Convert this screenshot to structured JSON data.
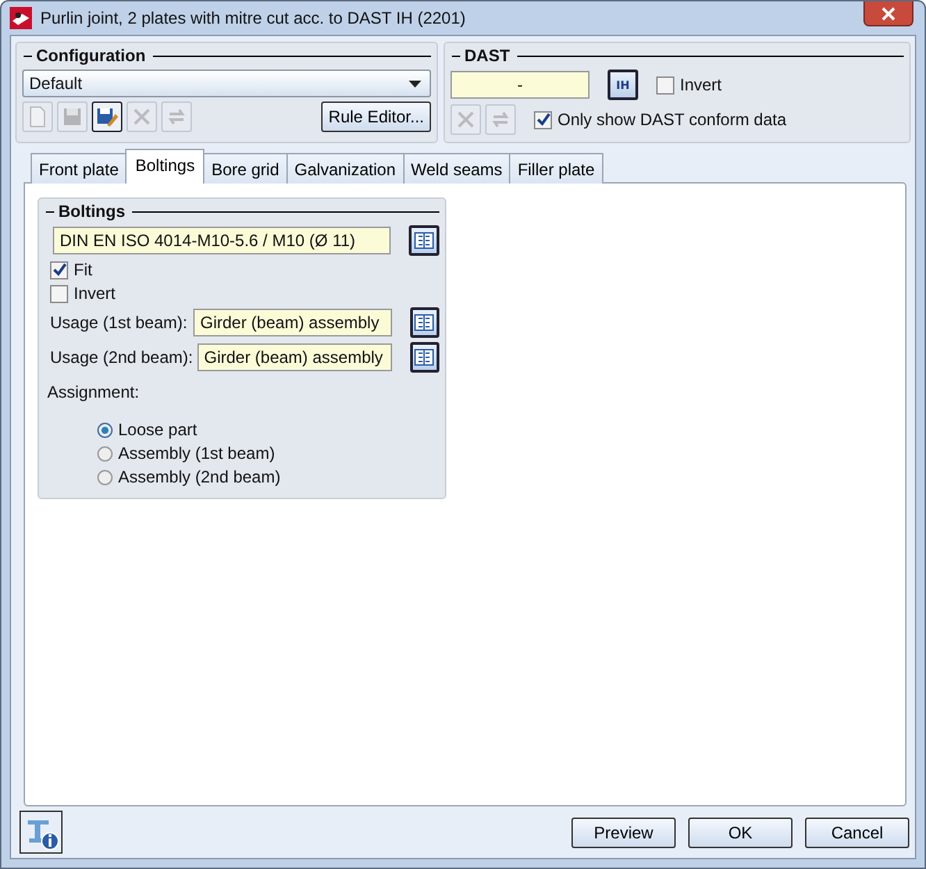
{
  "window": {
    "title": "Purlin joint, 2 plates with mitre cut acc. to DAST IH (2201)"
  },
  "configuration": {
    "title": "Configuration",
    "dropdown_value": "Default",
    "tools": [
      {
        "kind": "new",
        "disabled": true
      },
      {
        "kind": "save",
        "disabled": true
      },
      {
        "kind": "save-as",
        "disabled": false
      },
      {
        "kind": "delete",
        "disabled": true
      },
      {
        "kind": "refresh",
        "disabled": true
      }
    ],
    "rule_editor_button": "Rule Editor..."
  },
  "dast": {
    "title": "DAST",
    "value": "-",
    "picker_label": "IH",
    "invert": {
      "label": "Invert",
      "checked": false
    },
    "tools": [
      {
        "kind": "delete",
        "disabled": true
      },
      {
        "kind": "refresh",
        "disabled": true
      }
    ],
    "only_conform": {
      "label": "Only show DAST conform data",
      "checked": true
    }
  },
  "tabs": [
    {
      "label": "Front plate",
      "selected": false
    },
    {
      "label": "Boltings",
      "selected": true
    },
    {
      "label": "Bore grid",
      "selected": false
    },
    {
      "label": "Galvanization",
      "selected": false
    },
    {
      "label": "Weld seams",
      "selected": false
    },
    {
      "label": "Filler plate",
      "selected": false
    }
  ],
  "boltings": {
    "title": "Boltings",
    "bolt": "DIN EN ISO 4014-M10-5.6 / M10 (Ø 11)",
    "checks": [
      {
        "label": "Fit",
        "checked": true
      },
      {
        "label": "Invert",
        "checked": false
      }
    ],
    "usages": [
      {
        "label": "Usage (1st beam):",
        "value": "Girder (beam) assembly"
      },
      {
        "label": "Usage (2nd beam):",
        "value": "Girder (beam) assembly"
      }
    ],
    "assignment_label": "Assignment:",
    "assignment": [
      {
        "label": "Loose part",
        "selected": true
      },
      {
        "label": "Assembly (1st beam)",
        "selected": false
      },
      {
        "label": "Assembly (2nd beam)",
        "selected": false
      }
    ]
  },
  "buttons": [
    "Preview",
    "OK",
    "Cancel"
  ]
}
